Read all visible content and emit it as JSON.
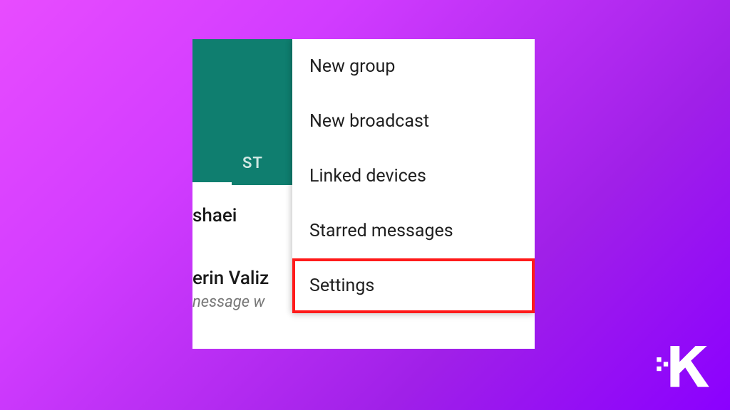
{
  "header": {
    "tab_label_partial": "ST"
  },
  "chat_list": {
    "item1_name_partial": "shaei",
    "item2_name_partial": "erin Valiz",
    "item2_preview_partial": "nessage w"
  },
  "menu": {
    "items": [
      {
        "label": "New group",
        "highlighted": false
      },
      {
        "label": "New broadcast",
        "highlighted": false
      },
      {
        "label": "Linked devices",
        "highlighted": false
      },
      {
        "label": "Starred messages",
        "highlighted": false
      },
      {
        "label": "Settings",
        "highlighted": true
      }
    ]
  },
  "watermark": {
    "letter": "K"
  }
}
